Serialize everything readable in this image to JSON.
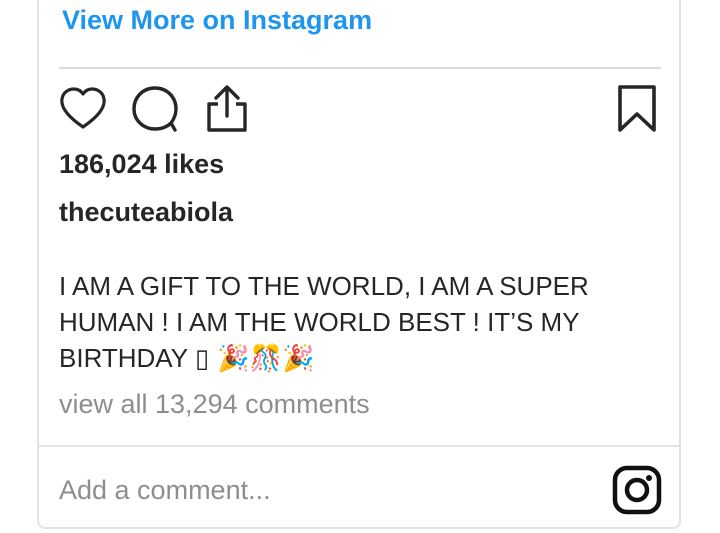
{
  "post": {
    "view_more_label": "View More on Instagram",
    "likes": "186,024 likes",
    "username": "thecuteabiola",
    "caption_text": "I AM A GIFT TO THE WORLD, I AM A SUPER HUMAN ! I AM THE WORLD BEST ! IT’S MY BIRTHDAY",
    "caption_emoji": "▯ 🎉🎊🎉",
    "comments_link": "view all 13,294 comments"
  },
  "comment_box": {
    "placeholder": "Add a comment..."
  },
  "icons": {
    "like": "heart-icon",
    "comment": "comment-bubble-icon",
    "share": "share-icon",
    "save": "bookmark-icon",
    "instagram": "instagram-icon"
  },
  "colors": {
    "link": "#1e96f0",
    "text": "#262626",
    "muted": "#8e8e8e",
    "border": "#dbdbdb"
  }
}
